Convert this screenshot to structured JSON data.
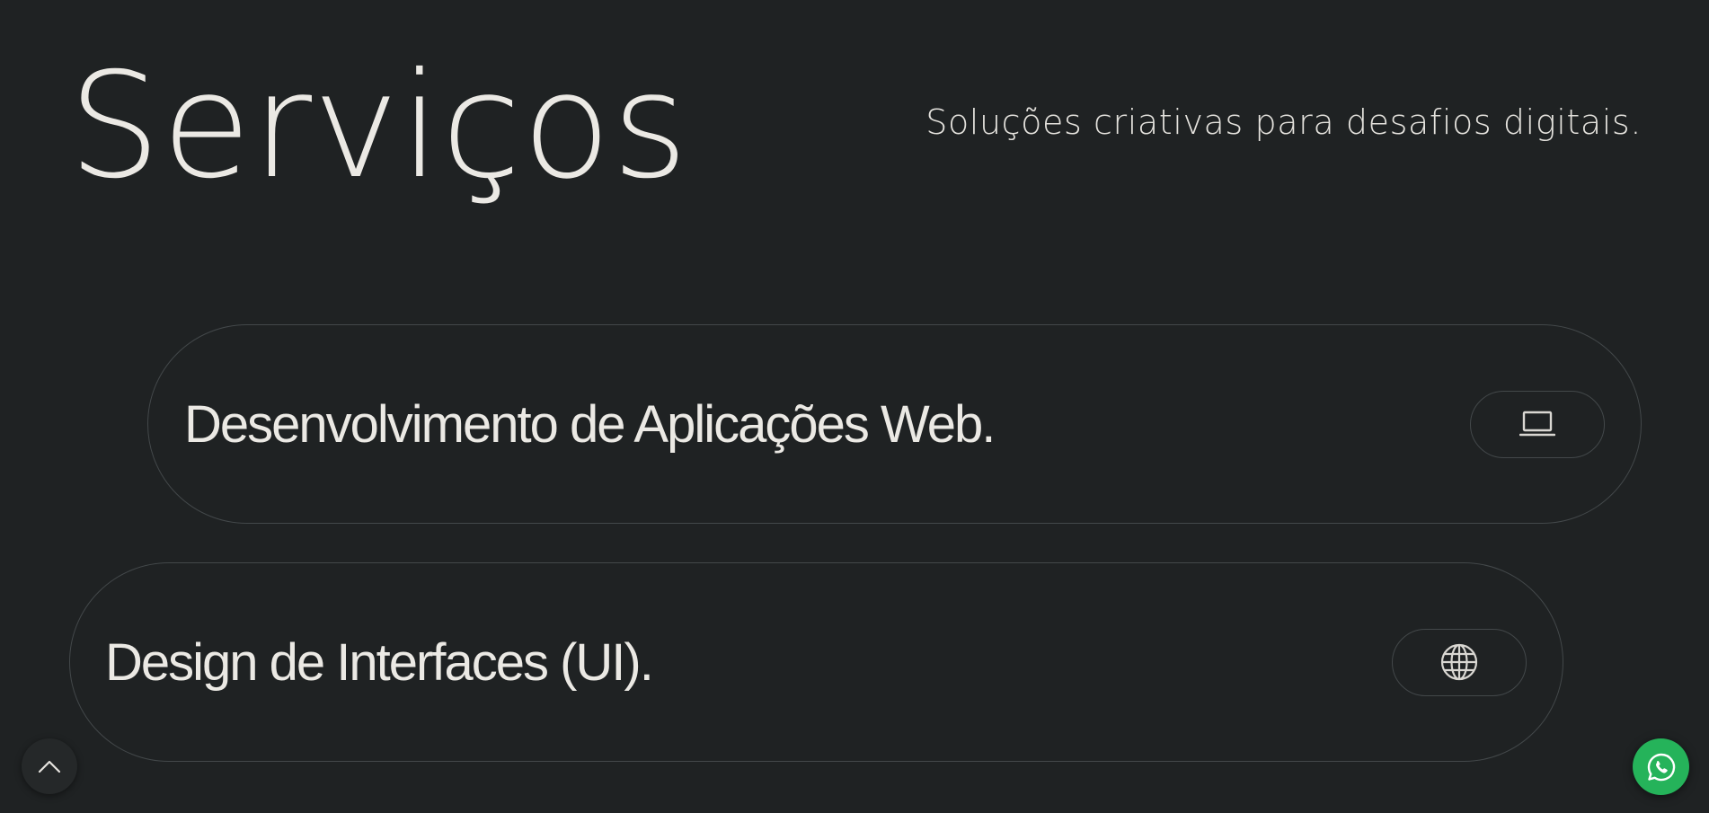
{
  "header": {
    "title": "Serviços",
    "subtitle": "Soluções criativas para desafios digitais."
  },
  "services": [
    {
      "label": "Desenvolvimento de Aplicações Web.",
      "icon": "laptop-icon"
    },
    {
      "label": "Design de Interfaces (UI).",
      "icon": "globe-icon"
    }
  ],
  "floating": {
    "scroll_top_icon": "chevron-up-icon",
    "whatsapp_icon": "whatsapp-icon"
  },
  "colors": {
    "background": "#1f2223",
    "text": "#ebe9e4",
    "border": "#43484a",
    "whatsapp": "#25b35a"
  }
}
